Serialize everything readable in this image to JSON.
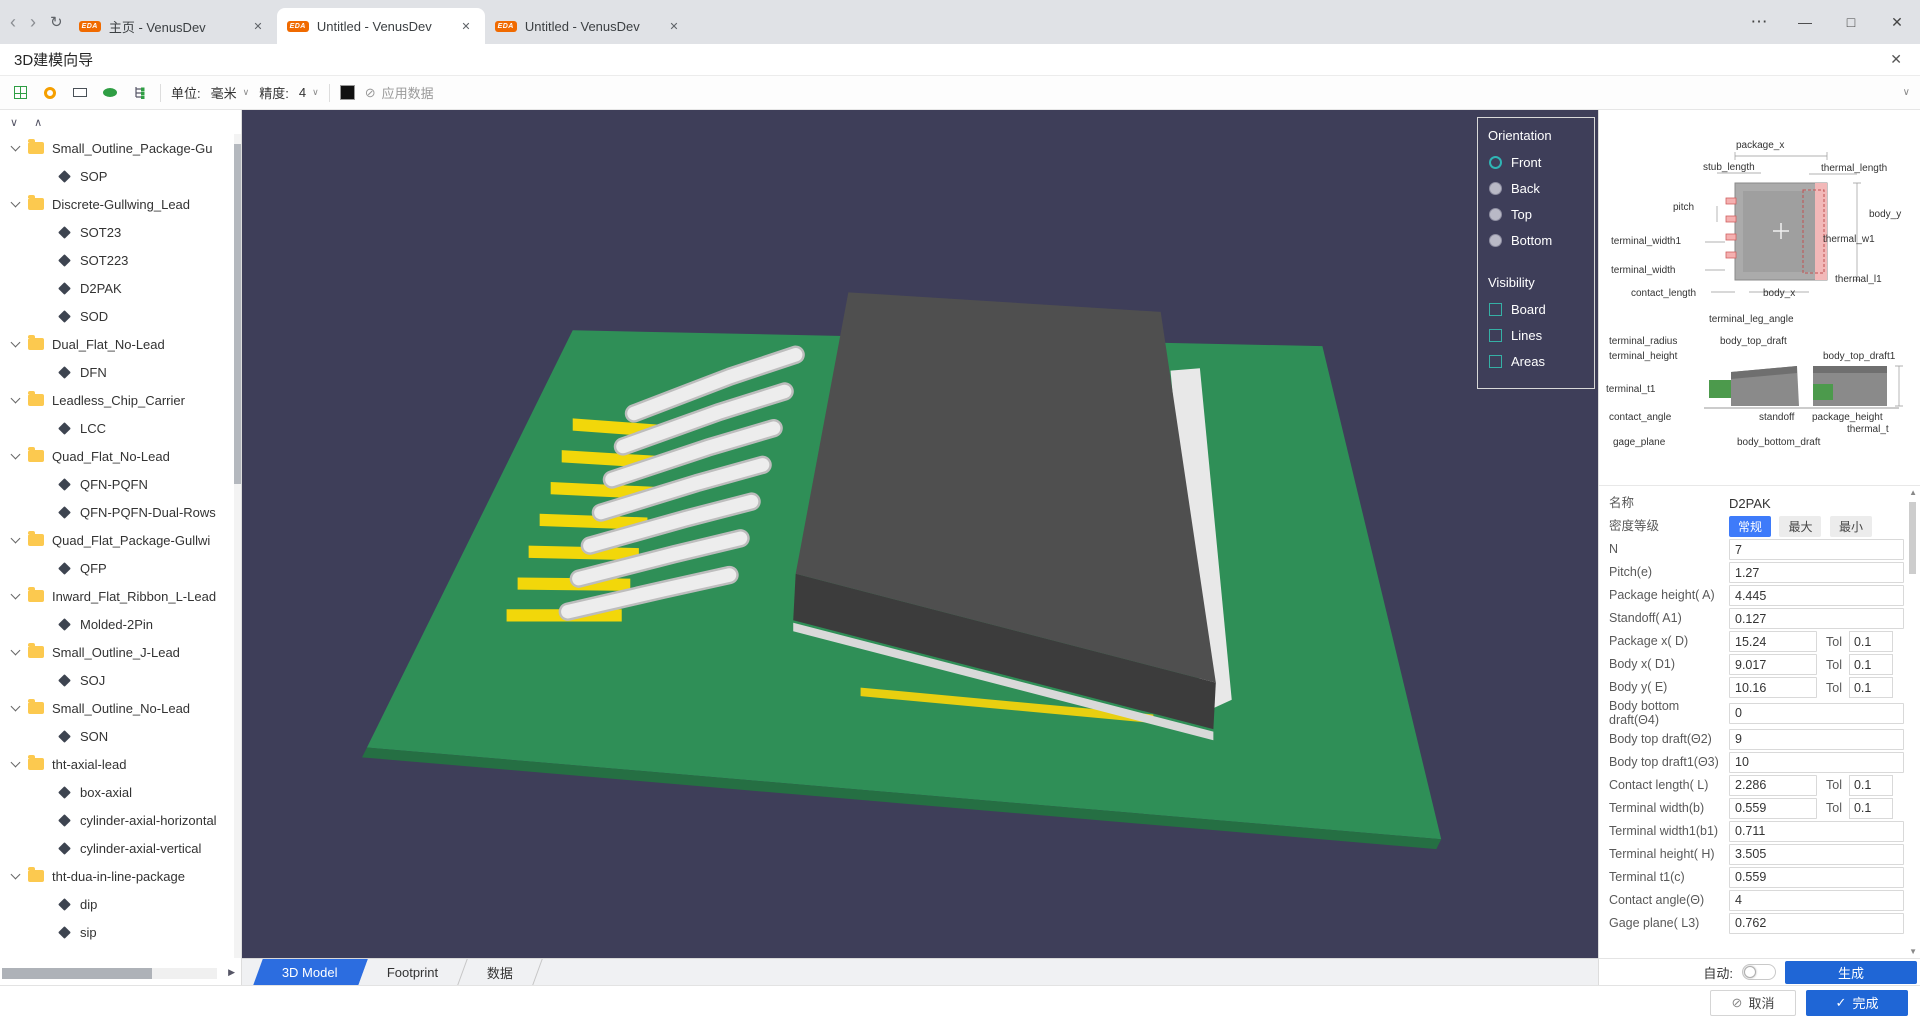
{
  "window": {
    "tabs": [
      {
        "badge": "EDA",
        "label": "主页 - VenusDev",
        "active": false
      },
      {
        "badge": "EDA",
        "label": "Untitled - VenusDev",
        "active": true
      },
      {
        "badge": "EDA",
        "label": "Untitled - VenusDev",
        "active": false
      }
    ]
  },
  "icons": {
    "back": "‹",
    "forward": "›",
    "refresh": "↻",
    "more": "⋯",
    "minimize": "—",
    "maximize": "□",
    "close": "✕",
    "tab_close": "✕",
    "dialog_close": "✕",
    "chevron_down": "∨",
    "chevron_up": "∧",
    "scroll_right": "▶",
    "scroll_up": "▲",
    "scroll_down": "▼",
    "apply": "⊘",
    "cancel": "⊘",
    "check": "✓"
  },
  "dialog": {
    "title": "3D建模向导"
  },
  "toolbar": {
    "unit_label": "单位:",
    "unit_value": "毫米",
    "precision_label": "精度:",
    "precision_value": "4",
    "apply_label": "应用数据"
  },
  "tree": {
    "items": [
      {
        "folder": true,
        "label": "Small_Outline_Package-Gu"
      },
      {
        "folder": false,
        "label": "SOP"
      },
      {
        "folder": true,
        "label": "Discrete-Gullwing_Lead"
      },
      {
        "folder": false,
        "label": "SOT23"
      },
      {
        "folder": false,
        "label": "SOT223"
      },
      {
        "folder": false,
        "label": "D2PAK"
      },
      {
        "folder": false,
        "label": "SOD"
      },
      {
        "folder": true,
        "label": "Dual_Flat_No-Lead"
      },
      {
        "folder": false,
        "label": "DFN"
      },
      {
        "folder": true,
        "label": "Leadless_Chip_Carrier"
      },
      {
        "folder": false,
        "label": "LCC"
      },
      {
        "folder": true,
        "label": "Quad_Flat_No-Lead"
      },
      {
        "folder": false,
        "label": "QFN-PQFN"
      },
      {
        "folder": false,
        "label": "QFN-PQFN-Dual-Rows"
      },
      {
        "folder": true,
        "label": "Quad_Flat_Package-Gullwi"
      },
      {
        "folder": false,
        "label": "QFP"
      },
      {
        "folder": true,
        "label": "Inward_Flat_Ribbon_L-Lead"
      },
      {
        "folder": false,
        "label": "Molded-2Pin"
      },
      {
        "folder": true,
        "label": "Small_Outline_J-Lead"
      },
      {
        "folder": false,
        "label": "SOJ"
      },
      {
        "folder": true,
        "label": "Small_Outline_No-Lead"
      },
      {
        "folder": false,
        "label": "SON"
      },
      {
        "folder": true,
        "label": "tht-axial-lead"
      },
      {
        "folder": false,
        "label": "box-axial"
      },
      {
        "folder": false,
        "label": "cylinder-axial-horizontal"
      },
      {
        "folder": false,
        "label": "cylinder-axial-vertical"
      },
      {
        "folder": true,
        "label": "tht-dua-in-line-package"
      },
      {
        "folder": false,
        "label": "dip"
      },
      {
        "folder": false,
        "label": "sip"
      }
    ]
  },
  "viewport": {
    "orientation": {
      "title": "Orientation",
      "options": [
        {
          "label": "Front",
          "selected": true
        },
        {
          "label": "Back",
          "selected": false
        },
        {
          "label": "Top",
          "selected": false
        },
        {
          "label": "Bottom",
          "selected": false
        }
      ]
    },
    "visibility": {
      "title": "Visibility",
      "options": [
        {
          "label": "Board",
          "checked": false
        },
        {
          "label": "Lines",
          "checked": false
        },
        {
          "label": "Areas",
          "checked": false
        }
      ]
    },
    "tabs": [
      {
        "label": "3D Model",
        "active": true
      },
      {
        "label": "Footprint",
        "active": false
      },
      {
        "label": "数据",
        "active": false
      }
    ],
    "auto_label": "自动:",
    "generate_label": "生成"
  },
  "diagram": {
    "labels": [
      "package_x",
      "stub_length",
      "thermal_length",
      "pitch",
      "body_y",
      "thermal_w1",
      "terminal_width1",
      "terminal_width",
      "contact_length",
      "body_x",
      "thermal_l1",
      "terminal_leg_angle",
      "terminal_radius",
      "body_top_draft",
      "terminal_height",
      "body_top_draft1",
      "terminal_t1",
      "contact_angle",
      "standoff",
      "package_height",
      "gage_plane",
      "body_bottom_draft",
      "thermal_t"
    ]
  },
  "params": {
    "name_label": "名称",
    "name_value": "D2PAK",
    "density_label": "密度等级",
    "density_options": [
      {
        "label": "常规",
        "selected": true
      },
      {
        "label": "最大",
        "selected": false
      },
      {
        "label": "最小",
        "selected": false
      }
    ],
    "tol_label": "Tol",
    "rows": [
      {
        "label": "N",
        "value": "7"
      },
      {
        "label": "Pitch(e)",
        "value": "1.27"
      },
      {
        "label": "Package height( A)",
        "value": "4.445"
      },
      {
        "label": "Standoff( A1)",
        "value": "0.127"
      },
      {
        "label": "Package x( D)",
        "value": "15.24",
        "tol": "0.1"
      },
      {
        "label": "Body x( D1)",
        "value": "9.017",
        "tol": "0.1"
      },
      {
        "label": "Body y( E)",
        "value": "10.16",
        "tol": "0.1"
      },
      {
        "label": "Body bottom draft(Θ4)",
        "value": "0"
      },
      {
        "label": "Body top draft(Θ2)",
        "value": "9"
      },
      {
        "label": "Body top draft1(Θ3)",
        "value": "10"
      },
      {
        "label": "Contact length( L)",
        "value": "2.286",
        "tol": "0.1"
      },
      {
        "label": "Terminal width(b)",
        "value": "0.559",
        "tol": "0.1"
      },
      {
        "label": "Terminal width1(b1)",
        "value": "0.711"
      },
      {
        "label": "Terminal height( H)",
        "value": "3.505"
      },
      {
        "label": "Terminal t1(c)",
        "value": "0.559"
      },
      {
        "label": "Contact angle(Θ)",
        "value": "4"
      },
      {
        "label": "Gage plane( L3)",
        "value": "0.762"
      }
    ]
  },
  "footer": {
    "cancel_label": "取消",
    "finish_label": "完成"
  },
  "colors": {
    "accent_blue": "#1f66d6",
    "tab_blue": "#2c6de0",
    "teal": "#2fb5b5",
    "board_green": "#2f8f57",
    "pad_yellow": "#f2d70a",
    "viewport_bg": "#3e3e59",
    "folder_yellow": "#fcc94f"
  }
}
